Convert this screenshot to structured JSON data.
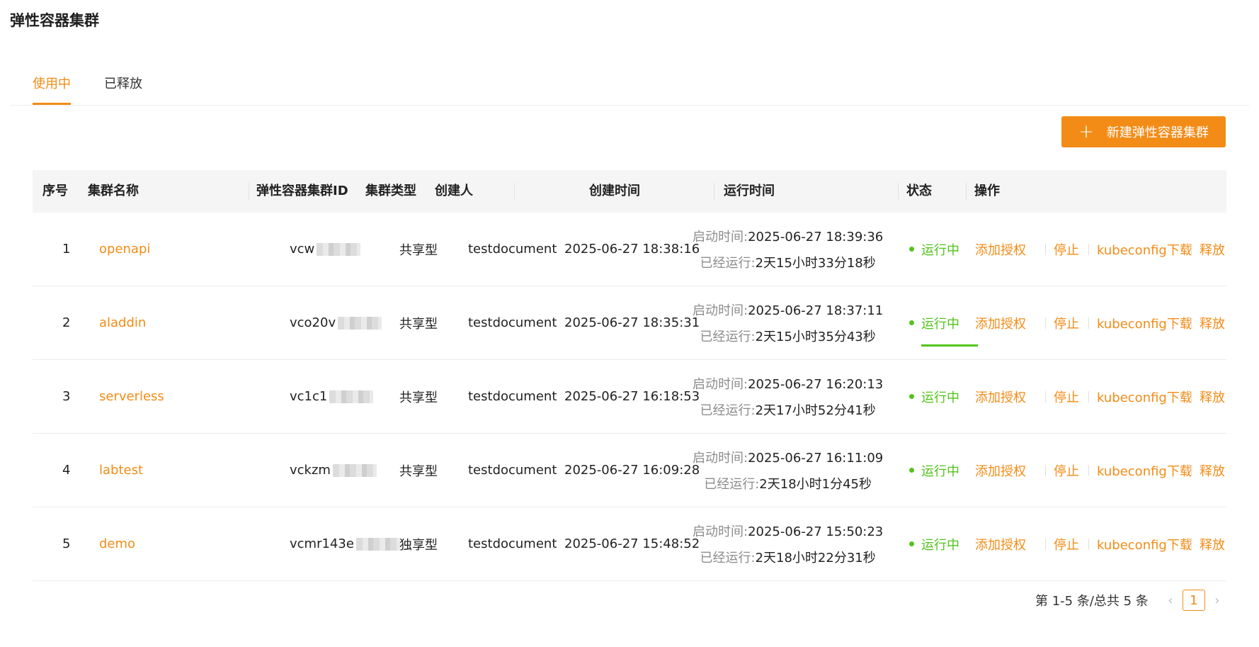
{
  "page": {
    "title": "弹性容器集群"
  },
  "tabs": [
    {
      "label": "使用中",
      "active": true
    },
    {
      "label": "已释放",
      "active": false
    }
  ],
  "toolbar": {
    "create_label": "新建弹性容器集群",
    "create_icon": "plus-icon"
  },
  "table": {
    "headers": {
      "index": "序号",
      "name": "集群名称",
      "id": "弹性容器集群ID",
      "type": "集群类型",
      "creator": "创建人",
      "created": "创建时间",
      "runtime": "运行时间",
      "status": "状态",
      "actions": "操作"
    },
    "runtime_labels": {
      "start": "启动时间:",
      "elapsed": "已经运行:"
    },
    "actions": {
      "authorize": "添加授权",
      "stop": "停止",
      "kubeconfig": "kubeconfig下载",
      "release": "释放"
    },
    "rows": [
      {
        "index": "1",
        "name": "openapi",
        "id_prefix": "vcw",
        "type": "共享型",
        "creator": "testdocument",
        "created": "2025-06-27 18:38:16",
        "start_time": "2025-06-27 18:39:36",
        "elapsed": "2天15小时33分18秒",
        "status": "运行中"
      },
      {
        "index": "2",
        "name": "aladdin",
        "id_prefix": "vco20v",
        "type": "共享型",
        "creator": "testdocument",
        "created": "2025-06-27 18:35:31",
        "start_time": "2025-06-27 18:37:11",
        "elapsed": "2天15小时35分43秒",
        "status": "运行中"
      },
      {
        "index": "3",
        "name": "serverless",
        "id_prefix": "vc1c1",
        "type": "共享型",
        "creator": "testdocument",
        "created": "2025-06-27 16:18:53",
        "start_time": "2025-06-27 16:20:13",
        "elapsed": "2天17小时52分41秒",
        "status": "运行中"
      },
      {
        "index": "4",
        "name": "labtest",
        "id_prefix": "vckzm",
        "type": "共享型",
        "creator": "testdocument",
        "created": "2025-06-27 16:09:28",
        "start_time": "2025-06-27 16:11:09",
        "elapsed": "2天18小时1分45秒",
        "status": "运行中"
      },
      {
        "index": "5",
        "name": "demo",
        "id_prefix": "vcmr143e",
        "type": "独享型",
        "creator": "testdocument",
        "created": "2025-06-27 15:48:52",
        "start_time": "2025-06-27 15:50:23",
        "elapsed": "2天18小时22分31秒",
        "status": "运行中"
      }
    ]
  },
  "pagination": {
    "total_text": "第 1-5 条/总共 5 条",
    "current_page": "1",
    "prev_icon": "chevron-left-icon",
    "next_icon": "chevron-right-icon"
  },
  "colors": {
    "accent": "#f38c17",
    "status_running": "#52c41a"
  }
}
